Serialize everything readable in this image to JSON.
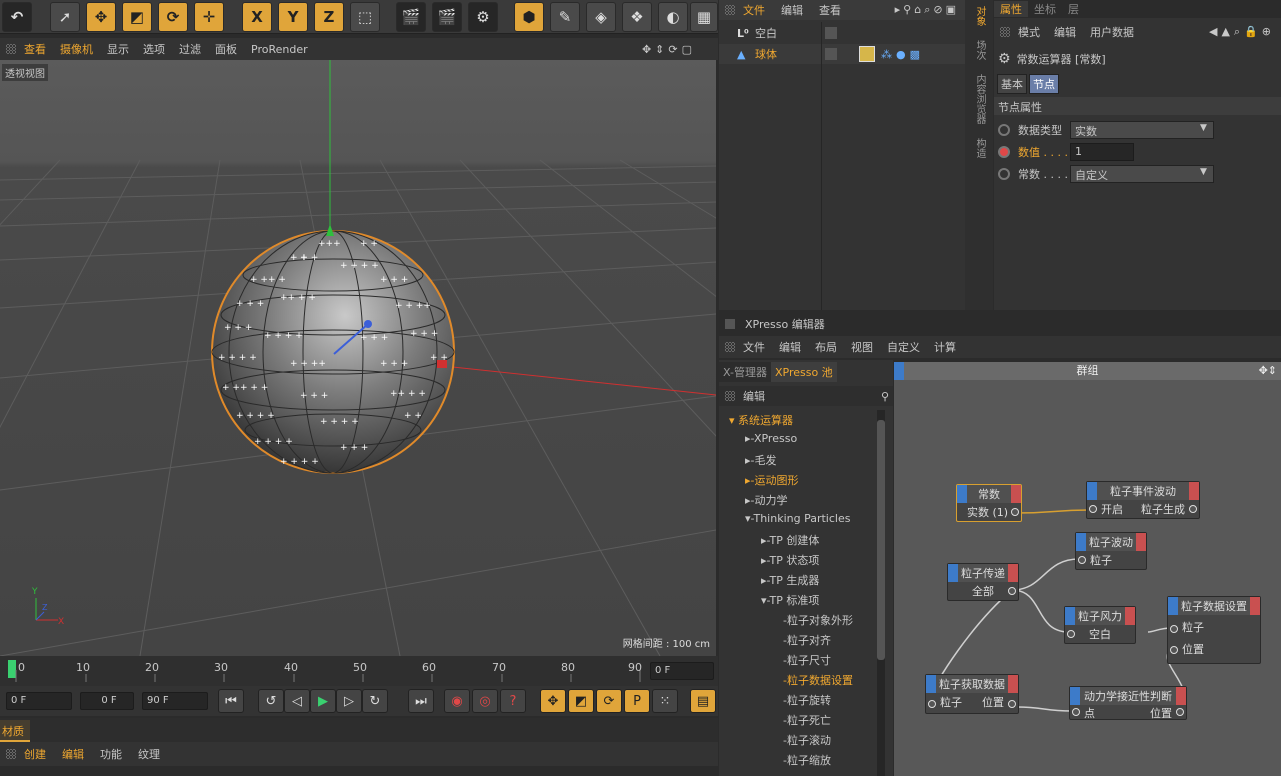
{
  "toolbar": {
    "axes": [
      "X",
      "Y",
      "Z"
    ]
  },
  "viewport": {
    "menu": [
      "查看",
      "摄像机",
      "显示",
      "选项",
      "过滤",
      "面板",
      "ProRender"
    ],
    "label": "透视视图",
    "grid_info": "网格间距 : 100 cm"
  },
  "timeline": {
    "ticks": [
      "0",
      "10",
      "20",
      "30",
      "40",
      "50",
      "60",
      "70",
      "80",
      "90"
    ],
    "current_frame": "0 F",
    "start": "0 F",
    "min": "0 F",
    "end": "90 F"
  },
  "material": {
    "tab": "材质",
    "menu": [
      "创建",
      "编辑",
      "功能",
      "纹理"
    ]
  },
  "object_manager": {
    "menu": [
      "文件",
      "编辑",
      "查看"
    ],
    "objects": [
      {
        "name": "空白",
        "icon": "null-icon"
      },
      {
        "name": "球体",
        "icon": "sphere-icon"
      }
    ]
  },
  "side_tabs": [
    "对象",
    "场次",
    "内容浏览器",
    "构造"
  ],
  "attributes": {
    "tabs": [
      "属性",
      "坐标",
      "层"
    ],
    "menu": [
      "模式",
      "编辑",
      "用户数据"
    ],
    "title": "常数运算器 [常数]",
    "subtabs": [
      "基本",
      "节点"
    ],
    "section": "节点属性",
    "fields": [
      {
        "label": "数据类型",
        "value": "实数"
      },
      {
        "label": "数值 . . . .",
        "value": "1"
      },
      {
        "label": "常数 . . . .",
        "value": "自定义"
      }
    ]
  },
  "xpresso": {
    "title": "XPresso 编辑器",
    "menu": [
      "文件",
      "编辑",
      "布局",
      "视图",
      "自定义",
      "计算"
    ],
    "tabs": [
      "X-管理器",
      "XPresso 池"
    ],
    "pool_menu": "编辑",
    "graph_title": "群组",
    "tree": [
      {
        "label": "系统运算器",
        "level": 0,
        "highlight": true
      },
      {
        "label": "XPresso",
        "level": 1
      },
      {
        "label": "毛发",
        "level": 1
      },
      {
        "label": "运动图形",
        "level": 1,
        "highlight": true
      },
      {
        "label": "动力学",
        "level": 1
      },
      {
        "label": "Thinking Particles",
        "level": 1
      },
      {
        "label": "TP 创建体",
        "level": 2
      },
      {
        "label": "TP 状态项",
        "level": 2
      },
      {
        "label": "TP 生成器",
        "level": 2
      },
      {
        "label": "TP 标准项",
        "level": 2
      },
      {
        "label": "粒子对象外形",
        "level": 3
      },
      {
        "label": "粒子对齐",
        "level": 3
      },
      {
        "label": "粒子尺寸",
        "level": 3
      },
      {
        "label": "粒子数据设置",
        "level": 3,
        "highlight": true
      },
      {
        "label": "粒子旋转",
        "level": 3
      },
      {
        "label": "粒子死亡",
        "level": 3
      },
      {
        "label": "粒子滚动",
        "level": 3
      },
      {
        "label": "粒子缩放",
        "level": 3
      }
    ],
    "nodes": [
      {
        "title": "常数",
        "ports": [
          "实数 (1)"
        ]
      },
      {
        "title": "粒子事件波动",
        "ports": [
          "开启",
          "粒子生成"
        ]
      },
      {
        "title": "粒子波动",
        "ports": [
          "粒子"
        ]
      },
      {
        "title": "粒子传递",
        "ports": [
          "全部"
        ]
      },
      {
        "title": "粒子风力",
        "ports": [
          "空白"
        ]
      },
      {
        "title": "粒子数据设置",
        "ports": [
          "粒子",
          "位置"
        ]
      },
      {
        "title": "粒子获取数据",
        "ports": [
          "粒子",
          "位置"
        ]
      },
      {
        "title": "动力学接近性判断",
        "ports": [
          "点",
          "位置"
        ]
      }
    ]
  }
}
